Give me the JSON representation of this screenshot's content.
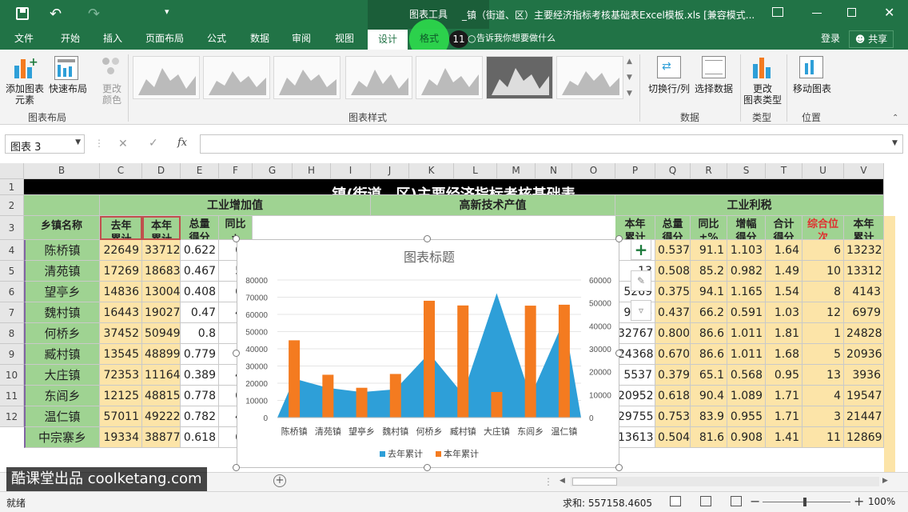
{
  "titlebar": {
    "save_icon": "save-icon",
    "undo_icon": "undo-icon",
    "redo_icon": "redo-icon",
    "context_tab": "图表工具",
    "title": "_镇（街道、区）主要经济指标考核基础表Excel模板.xls  [兼容模式..."
  },
  "tabs": [
    "文件",
    "开始",
    "插入",
    "页面布局",
    "公式",
    "数据",
    "审阅",
    "视图",
    "设计",
    "格式"
  ],
  "tell_me": "告诉我你想要做什么",
  "badge": "11",
  "login": "登录",
  "share": "共享",
  "ribbon": {
    "add_element": "添加图表\n元素",
    "quick_layout": "快速布局",
    "change_color": "更改\n颜色",
    "group_layout": "图表布局",
    "group_styles": "图表样式",
    "switch_rowcol": "切换行/列",
    "select_data": "选择数据",
    "group_data": "数据",
    "change_type": "更改\n图表类型",
    "group_type": "类型",
    "move_chart": "移动图表",
    "group_location": "位置"
  },
  "formula_bar": {
    "name_box": "图表 3",
    "fx": "fx",
    "formula": ""
  },
  "columns": [
    "B",
    "C",
    "D",
    "E",
    "F",
    "G",
    "H",
    "I",
    "J",
    "K",
    "L",
    "M",
    "N",
    "O",
    "P",
    "Q",
    "R",
    "S",
    "T",
    "U",
    "V"
  ],
  "rows": [
    "1",
    "2",
    "3",
    "4",
    "5",
    "6",
    "7",
    "8",
    "9",
    "10",
    "11",
    "12"
  ],
  "table": {
    "title": "镇(街道、区)主要经济指标考核基础表",
    "group1": "工业增加值",
    "group2": "高新技术产值",
    "group3": "工业利税",
    "h_town": "乡镇名称",
    "h_last": "去年\n累计",
    "h_this": "本年\n累计",
    "h_score": "总量\n得分",
    "h_yoy": "同比\n±",
    "h_p_this": "本年\n累计",
    "h_q": "总量\n得分",
    "h_r": "同比\n±%",
    "h_s": "增幅\n得分",
    "h_t": "合计\n得分",
    "h_u": "综合位\n次",
    "h_v": "本年\n累计",
    "rows": [
      {
        "town": "陈桥镇",
        "c": "22649",
        "d": "33712",
        "e": "0.622",
        "f": "63",
        "p": "15",
        "q": "0.537",
        "r": "91.1",
        "s": "1.103",
        "t": "1.64",
        "u": "6",
        "v": "13232"
      },
      {
        "town": "清苑镇",
        "c": "17269",
        "d": "18683",
        "e": "0.467",
        "f": "59",
        "p": "13",
        "q": "0.508",
        "r": "85.2",
        "s": "0.982",
        "t": "1.49",
        "u": "10",
        "v": "13312"
      },
      {
        "town": "望亭乡",
        "c": "14836",
        "d": "13004",
        "e": "0.408",
        "f": "69",
        "p": "5269",
        "q": "0.375",
        "r": "94.1",
        "s": "1.165",
        "t": "1.54",
        "u": "8",
        "v": "4143"
      },
      {
        "town": "魏村镇",
        "c": "16443",
        "d": "19027",
        "e": "0.47",
        "f": "40",
        "p": "9266",
        "q": "0.437",
        "r": "66.2",
        "s": "0.591",
        "t": "1.03",
        "u": "12",
        "v": "6979"
      },
      {
        "town": "何桥乡",
        "c": "37452",
        "d": "50949",
        "e": "0.8",
        "f": "",
        "p": "32767",
        "q": "0.800",
        "r": "86.6",
        "s": "1.011",
        "t": "1.81",
        "u": "1",
        "v": "24828"
      },
      {
        "town": "臧村镇",
        "c": "13545",
        "d": "48899",
        "e": "0.779",
        "f": "62",
        "p": "24368",
        "q": "0.670",
        "r": "86.6",
        "s": "1.011",
        "t": "1.68",
        "u": "5",
        "v": "20936"
      },
      {
        "town": "大庄镇",
        "c": "72353",
        "d": "11164",
        "e": "0.389",
        "f": "42",
        "p": "5537",
        "q": "0.379",
        "r": "65.1",
        "s": "0.568",
        "t": "0.95",
        "u": "13",
        "v": "3936"
      },
      {
        "town": "东闾乡",
        "c": "12125",
        "d": "48815",
        "e": "0.778",
        "f": "63",
        "p": "20952",
        "q": "0.618",
        "r": "90.4",
        "s": "1.089",
        "t": "1.71",
        "u": "4",
        "v": "19547"
      },
      {
        "town": "温仁镇",
        "c": "57011",
        "d": "49222",
        "e": "0.782",
        "f": "49",
        "p": "29755",
        "q": "0.753",
        "r": "83.9",
        "s": "0.955",
        "t": "1.71",
        "u": "3",
        "v": "21447"
      },
      {
        "town": "中宗寨乡",
        "c": "19334",
        "d": "38877",
        "e": "0.618",
        "f": "60",
        "p": "13613",
        "q": "0.504",
        "r": "81.6",
        "s": "0.908",
        "t": "1.41",
        "u": "11",
        "v": "12869"
      }
    ]
  },
  "chart_data": {
    "type": "bar",
    "title": "图表标题",
    "categories": [
      "陈桥镇",
      "清苑镇",
      "望亭乡",
      "魏村镇",
      "何桥乡",
      "臧村镇",
      "大庄镇",
      "东闾乡",
      "温仁镇"
    ],
    "series": [
      {
        "name": "去年累计",
        "type": "area",
        "axis": "left",
        "color": "#2e9fd8",
        "values": [
          22649,
          17269,
          14836,
          16443,
          37452,
          13545,
          72353,
          12125,
          57011
        ]
      },
      {
        "name": "本年累计",
        "type": "bar",
        "axis": "right",
        "color": "#f47b20",
        "values": [
          33712,
          18683,
          13004,
          19027,
          50949,
          48899,
          11164,
          48815,
          49222
        ]
      }
    ],
    "yleft": {
      "min": 0,
      "max": 80000,
      "ticks": [
        0,
        10000,
        20000,
        30000,
        40000,
        50000,
        60000,
        70000,
        80000
      ]
    },
    "yright": {
      "min": 0,
      "max": 60000,
      "ticks": [
        0,
        10000,
        20000,
        30000,
        40000,
        50000,
        60000
      ]
    },
    "legend": "bottom"
  },
  "sheet_tabs": {
    "add": "+"
  },
  "status": {
    "ready": "就绪",
    "sum": "求和: 557158.4605",
    "zoom": "100%"
  },
  "watermark": "酷课堂出品 coolketang.com"
}
